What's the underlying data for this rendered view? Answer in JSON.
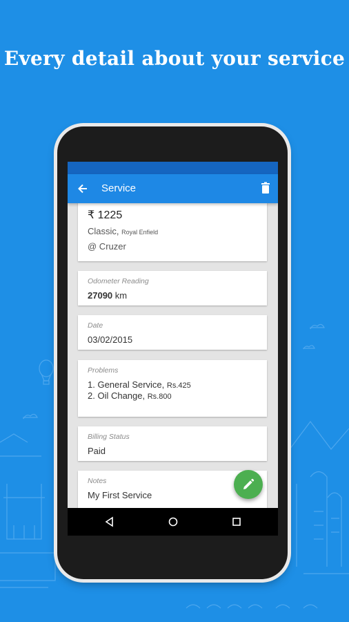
{
  "headline": "Every detail about your service",
  "appbar": {
    "title": "Service"
  },
  "summary": {
    "amount": "₹ 1225",
    "model": "Classic,",
    "make": "Royal Enfield",
    "location": "@ Cruzer"
  },
  "odometer": {
    "label": "Odometer Reading",
    "value": "27090",
    "unit": "km"
  },
  "date": {
    "label": "Date",
    "value": "03/02/2015"
  },
  "problems": {
    "label": "Problems",
    "items": [
      {
        "text": "1. General Service,",
        "price": "Rs.425"
      },
      {
        "text": "2. Oil Change,",
        "price": "Rs.800"
      }
    ]
  },
  "billing": {
    "label": "Billing Status",
    "value": "Paid"
  },
  "notes": {
    "label": "Notes",
    "value": "My First Service"
  },
  "colors": {
    "background": "#1e8fe6",
    "appbar": "#1e88e5",
    "statusbar": "#1565c0",
    "fab": "#4caf50"
  },
  "icons": [
    "back-arrow-icon",
    "trash-icon",
    "pencil-icon",
    "nav-back-icon",
    "nav-home-icon",
    "nav-recents-icon"
  ]
}
